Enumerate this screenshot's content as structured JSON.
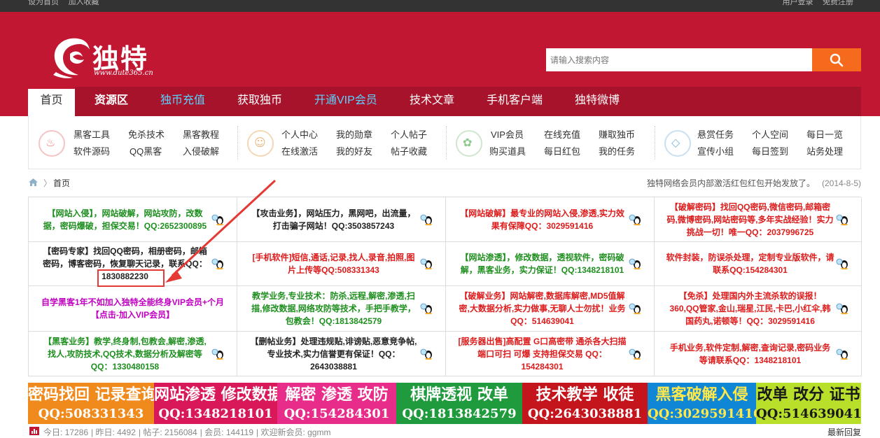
{
  "topbar": {
    "set_home": "设为首页",
    "add_fav": "加入收藏",
    "user": "用户登录",
    "register": "免费注册"
  },
  "logo": {
    "brand": "独特",
    "url": "www.dute365.cn"
  },
  "search": {
    "placeholder": "请输入搜索内容"
  },
  "nav": [
    {
      "label": "首页"
    },
    {
      "label": "资源区"
    },
    {
      "label": "独币充值"
    },
    {
      "label": "获取独币"
    },
    {
      "label": "开通VIP会员"
    },
    {
      "label": "技术文章"
    },
    {
      "label": "手机客户端"
    },
    {
      "label": "独特微博"
    }
  ],
  "quick": [
    {
      "icon": "flame-icon",
      "color": "#f08a8a",
      "links": [
        "黑客工具",
        "免杀技术",
        "黑客教程",
        "软件源码",
        "QQ黑客",
        "入侵破解"
      ]
    },
    {
      "icon": "users-icon",
      "color": "#e8b57a",
      "links": [
        "个人中心",
        "我的勋章",
        "个人帖子",
        "在线激活",
        "我的好友",
        "帖子收藏"
      ]
    },
    {
      "icon": "gift-icon",
      "color": "#8dc88d",
      "links": [
        "VIP会员",
        "在线充值",
        "赚取独币",
        "购买道具",
        "每日红包",
        "我的任务"
      ]
    },
    {
      "icon": "diamond-icon",
      "color": "#7fb7e0",
      "links": [
        "悬赏任务",
        "个人空间",
        "每日一览",
        "宣传小组",
        "每日签到",
        "站务处理"
      ]
    }
  ],
  "breadcrumb": {
    "sep": "〉",
    "current": "首页",
    "notice": "独特网络会员内部激活红包红包开始发放了。",
    "date": "(2014-8-5)"
  },
  "ads": [
    [
      {
        "text": "【网站入侵】，网站破解，网站攻防，改数据，密码爆破，担保交易！QQ:2652300895",
        "c": "g"
      },
      {
        "text": "【攻击业务】，网站压力，黑网吧，出流量，打击骗子网站！QQ:3503857243",
        "c": "k"
      },
      {
        "text": "【网站破解】最专业的网站入侵,渗透,实力效果有保障QQ：3029591416",
        "c": "r"
      },
      {
        "text": "【破解密码】找回QQ密码,微信密码,邮箱密码,微博密码,网站密码等,多年实战经验！实力挑战一切！唯一QQ：2037996725",
        "c": "r"
      }
    ],
    [
      {
        "text": "【密码专家】找回QQ密码，相册密码，邮箱密码，博客密码，恢复聊天记录，联系QQ：1830882230",
        "c": "k"
      },
      {
        "text": "[手机软件]短信,通话,记录,找人,录音,拍照,图片上传等QQ:508331343",
        "c": "r"
      },
      {
        "text": "【网站渗透】，修改数据，透视软件，密码破解，黑客业务，实力保证！QQ:1348218101",
        "c": "g"
      },
      {
        "text": "软件封装，防误杀处理，定制专业版软件，请联系QQ:154284301",
        "c": "r"
      }
    ],
    [
      {
        "text": "自学黑客1年不如加入独特全能终身VIP会员+个月【点击-加入VIP会员】",
        "c": "p"
      },
      {
        "text": "教学业务,专业技术：防杀,远程,解密,渗透,扫描,修改数据,网络攻防等技术，手把手教学，包教会！QQ:1813842579",
        "c": "g"
      },
      {
        "text": "【破解业务】网站解密,数据库解密,MD5值解密,大数据分析,实力做事,无聊人士勿扰！业务QQ：514639041",
        "c": "r"
      },
      {
        "text": "【免杀】处理国内外主流杀软的误报！360,QQ管家,金山,瑞星,江民,卡巴,小红伞,韩国药丸,诺顿等！QQ：3029591416",
        "c": "r"
      }
    ],
    [
      {
        "text": "【黑客业务】教学,终身制,包教会,解密,渗透,找人,攻防技术,QQ技术,数据分析及解密等QQ：1330480158",
        "c": "g"
      },
      {
        "text": "【删帖业务】处理违规贴,诽谤贴,恶意竞争帖,专业技术,实力信誉更有保证！QQ：2643038881",
        "c": "k"
      },
      {
        "text": "[服务器出售]高配置 G口高密带 通杀各大扫描端口可扫 可爆 支持担保交易 QQ：154284301",
        "c": "r"
      },
      {
        "text": "手机业务,软件定制,解密,查询记录,密码业务等请联系QQ：1348218101",
        "c": "r"
      }
    ]
  ],
  "banners": [
    {
      "l1": "密码找回 记录查询",
      "l2": "QQ:508331343",
      "bg": "#f08a1c",
      "fg": "#fff"
    },
    {
      "l1": "网站渗透 修改数据",
      "l2": "QQ:1348218101",
      "bg": "#d9185a",
      "fg": "#fff"
    },
    {
      "l1": "解密 渗透 攻防",
      "l2": "QQ:154284301",
      "bg": "#e82c8a",
      "fg": "#fff"
    },
    {
      "l1": "棋牌透视 改单",
      "l2": "QQ:1813842579",
      "bg": "#1f9a3c",
      "fg": "#fff"
    },
    {
      "l1": "技术教学 收徒",
      "l2": "QQ:2643038881",
      "bg": "#c4141c",
      "fg": "#fff"
    },
    {
      "l1": "黑客破解入侵",
      "l2": "QQ:3029591416",
      "bg": "#0f86d6",
      "fg": "#ffe94a"
    },
    {
      "l1": "改单 改分 证书",
      "l2": "QQ:514639041",
      "bg": "#b8e02a",
      "fg": "#1a1a1a"
    }
  ],
  "stats": {
    "today": "今日: 17286",
    "yesterday": "昨日: 4492",
    "posts": "帖子: 2156084",
    "members": "会员: 144119",
    "newest": "欢迎新会员: ggmm",
    "latest": "最新回复"
  },
  "colors": {
    "header": "#c21733",
    "nav": "#a6132b",
    "search_btn": "#f56a1c",
    "highlight_box": "#e53935"
  }
}
